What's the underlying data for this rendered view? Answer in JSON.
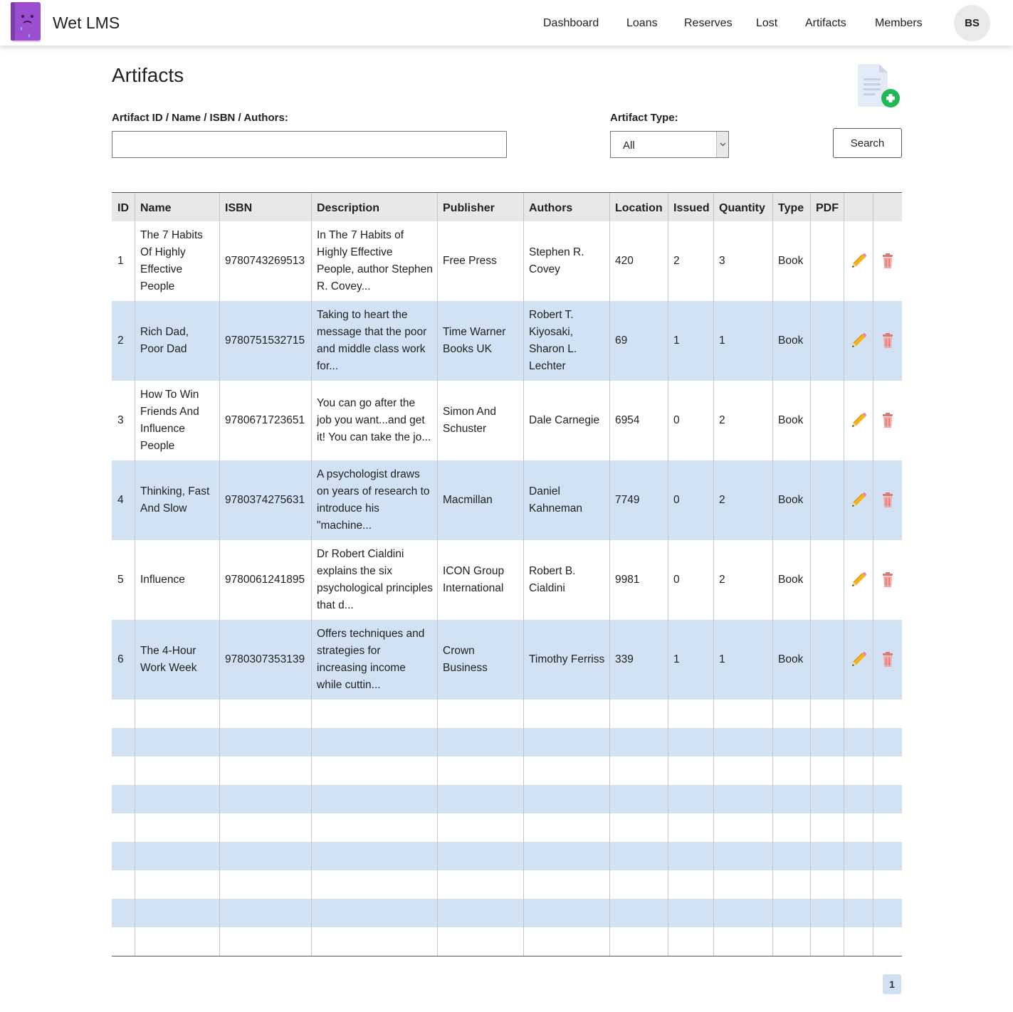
{
  "app": {
    "title": "Wet LMS",
    "user_initials": "BS"
  },
  "nav": {
    "items": [
      {
        "label": "Dashboard"
      },
      {
        "label": "Loans"
      },
      {
        "label": "Reserves"
      },
      {
        "label": "Lost"
      },
      {
        "label": "Artifacts"
      },
      {
        "label": "Members"
      }
    ]
  },
  "page": {
    "title": "Artifacts"
  },
  "filters": {
    "query_label": "Artifact ID / Name / ISBN / Authors:",
    "query_value": "",
    "type_label": "Artifact Type:",
    "type_value": "All",
    "search_label": "Search"
  },
  "table": {
    "columns": [
      "ID",
      "Name",
      "ISBN",
      "Description",
      "Publisher",
      "Authors",
      "Location",
      "Issued",
      "Quantity",
      "Type",
      "PDF",
      "",
      ""
    ],
    "rows": [
      {
        "id": "1",
        "name": "The 7 Habits Of Highly Effective People",
        "isbn": "9780743269513",
        "description": "In The 7 Habits of Highly Effective People, author Stephen R. Covey...",
        "publisher": "Free Press",
        "authors": "Stephen R. Covey",
        "location": "420",
        "issued": "2",
        "quantity": "3",
        "type": "Book",
        "pdf": ""
      },
      {
        "id": "2",
        "name": "Rich Dad, Poor Dad",
        "isbn": "9780751532715",
        "description": "Taking to heart the message that the poor and middle class work for...",
        "publisher": "Time Warner Books UK",
        "authors": "Robert T. Kiyosaki, Sharon L. Lechter",
        "location": "69",
        "issued": "1",
        "quantity": "1",
        "type": "Book",
        "pdf": ""
      },
      {
        "id": "3",
        "name": "How To Win Friends And Influence People",
        "isbn": "9780671723651",
        "description": "You can go after the job you want...and get it! You can take the jo...",
        "publisher": "Simon And Schuster",
        "authors": "Dale Carnegie",
        "location": "6954",
        "issued": "0",
        "quantity": "2",
        "type": "Book",
        "pdf": ""
      },
      {
        "id": "4",
        "name": "Thinking, Fast And Slow",
        "isbn": "9780374275631",
        "description": "A psychologist draws on years of research to introduce his \"machine...",
        "publisher": "Macmillan",
        "authors": "Daniel Kahneman",
        "location": "7749",
        "issued": "0",
        "quantity": "2",
        "type": "Book",
        "pdf": ""
      },
      {
        "id": "5",
        "name": "Influence",
        "isbn": "9780061241895",
        "description": "Dr Robert Cialdini explains the six psychological principles that d...",
        "publisher": "ICON Group International",
        "authors": "Robert B. Cialdini",
        "location": "9981",
        "issued": "0",
        "quantity": "2",
        "type": "Book",
        "pdf": ""
      },
      {
        "id": "6",
        "name": "The 4-Hour Work Week",
        "isbn": "9780307353139",
        "description": "Offers techniques and strategies for increasing income while cuttin...",
        "publisher": "Crown Business",
        "authors": "Timothy Ferriss",
        "location": "339",
        "issued": "1",
        "quantity": "1",
        "type": "Book",
        "pdf": ""
      }
    ],
    "empty_rows": 9
  },
  "pagination": {
    "current_page": "1"
  },
  "icons": {
    "edit": "pencil-icon",
    "delete": "trash-icon",
    "add_artifact": "add-document-icon",
    "logo": "sad-book-icon"
  }
}
